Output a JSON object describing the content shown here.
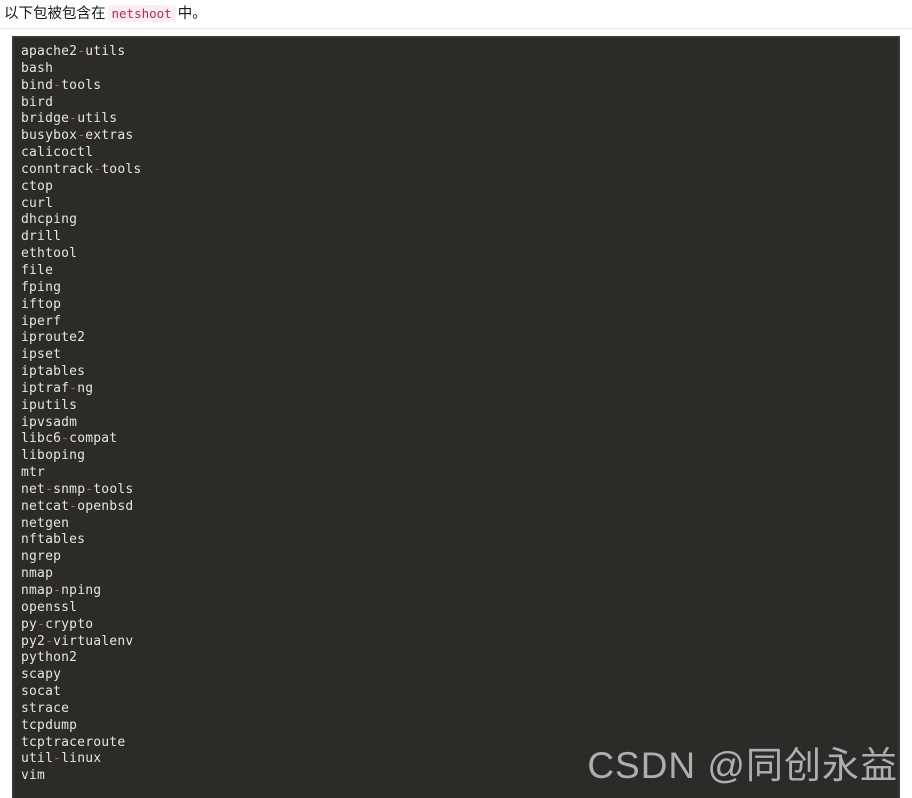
{
  "header": {
    "text_before": "以下包被包含在",
    "inline_code": "netshoot",
    "text_after": "中。"
  },
  "code_block": {
    "language": "text",
    "background_color": "#2d2b28",
    "text_color": "#e6e4e0",
    "separator_color": "#c85a6e",
    "packages": [
      "apache2-utils",
      "bash",
      "bind-tools",
      "bird",
      "bridge-utils",
      "busybox-extras",
      "calicoctl",
      "conntrack-tools",
      "ctop",
      "curl",
      "dhcping",
      "drill",
      "ethtool",
      "file",
      "fping",
      "iftop",
      "iperf",
      "iproute2",
      "ipset",
      "iptables",
      "iptraf-ng",
      "iputils",
      "ipvsadm",
      "libc6-compat",
      "liboping",
      "mtr",
      "net-snmp-tools",
      "netcat-openbsd",
      "netgen",
      "nftables",
      "ngrep",
      "nmap",
      "nmap-nping",
      "openssl",
      "py-crypto",
      "py2-virtualenv",
      "python2",
      "scapy",
      "socat",
      "strace",
      "tcpdump",
      "tcptraceroute",
      "util-linux",
      "vim"
    ]
  },
  "watermark": {
    "text": "CSDN @同创永益"
  }
}
